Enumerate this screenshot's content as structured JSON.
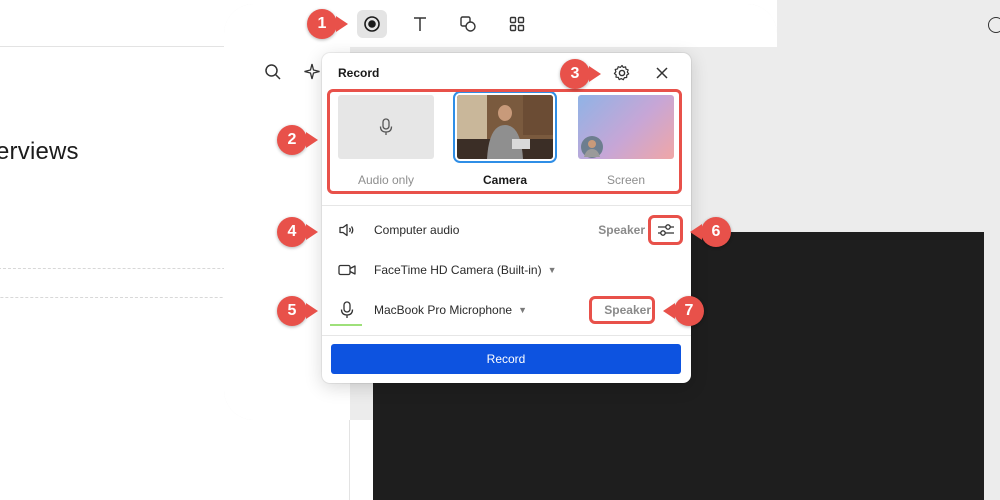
{
  "background": {
    "heading_fragment": "erviews"
  },
  "toolbar": {
    "tools": [
      {
        "icon": "record-icon",
        "active": true
      },
      {
        "icon": "text-icon",
        "active": false
      },
      {
        "icon": "shapes-icon",
        "active": false
      },
      {
        "icon": "grid-icon",
        "active": false
      }
    ]
  },
  "record_panel": {
    "title": "Record",
    "modes": [
      {
        "label": "Audio only",
        "selected": false
      },
      {
        "label": "Camera",
        "selected": true
      },
      {
        "label": "Screen",
        "selected": false
      }
    ],
    "computer_audio": {
      "label": "Computer audio",
      "output": "Speaker"
    },
    "camera": {
      "label": "FaceTime HD Camera (Built-in)"
    },
    "microphone": {
      "label": "MacBook Pro Microphone",
      "output": "Speaker"
    },
    "record_button": "Record"
  },
  "callouts": {
    "labels": [
      "1",
      "2",
      "3",
      "4",
      "5",
      "6",
      "7"
    ]
  },
  "colors": {
    "accent": "#0d53e0",
    "callout": "#e8514a",
    "selection": "#2f8ee6",
    "mic_level": "#9ee07a"
  }
}
